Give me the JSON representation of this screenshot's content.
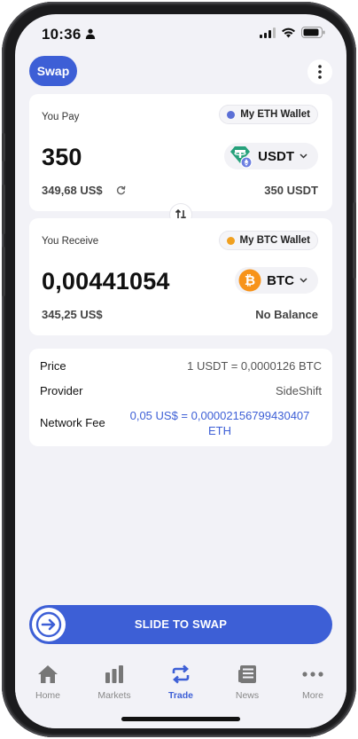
{
  "status": {
    "time": "10:36"
  },
  "header": {
    "title": "Swap"
  },
  "pay": {
    "label": "You Pay",
    "wallet": "My ETH Wallet",
    "wallet_color": "#5b6fd6",
    "amount": "350",
    "token": "USDT",
    "token_color": "#26a17b",
    "fiat": "349,68 US$",
    "balance": "350 USDT"
  },
  "receive": {
    "label": "You Receive",
    "wallet": "My BTC Wallet",
    "wallet_color": "#f0a020",
    "amount": "0,00441054",
    "token": "BTC",
    "token_color": "#f7931a",
    "fiat": "345,25 US$",
    "balance": "No Balance"
  },
  "info": {
    "price_label": "Price",
    "price_value": "1 USDT = 0,0000126 BTC",
    "provider_label": "Provider",
    "provider_value": "SideShift",
    "fee_label": "Network Fee",
    "fee_value": "0,05 US$ = 0,00002156799430407 ETH"
  },
  "slider": {
    "label": "SLIDE TO SWAP"
  },
  "tabs": [
    {
      "label": "Home",
      "icon": "home-icon"
    },
    {
      "label": "Markets",
      "icon": "bar-chart-icon"
    },
    {
      "label": "Trade",
      "icon": "swap-arrows-icon"
    },
    {
      "label": "News",
      "icon": "newspaper-icon"
    },
    {
      "label": "More",
      "icon": "ellipsis-icon"
    }
  ],
  "colors": {
    "accent": "#3d5fd6",
    "background": "#f2f2f7"
  }
}
